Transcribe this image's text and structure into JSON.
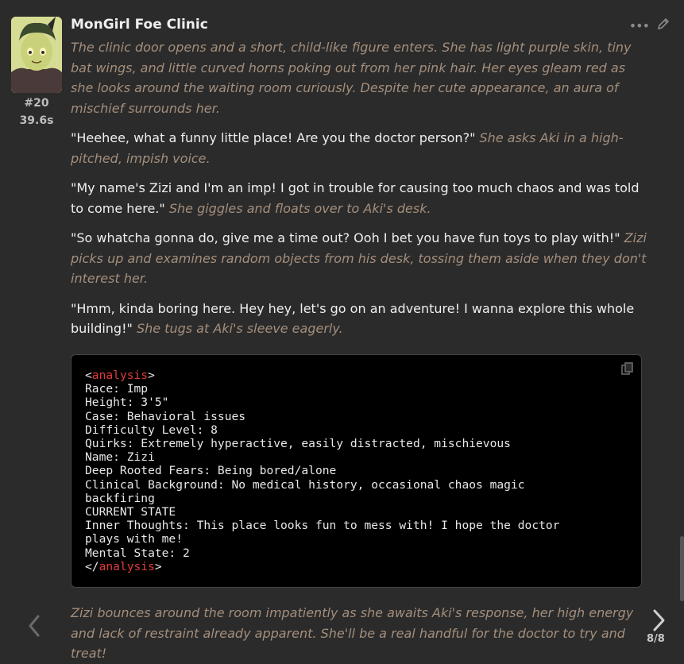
{
  "message": {
    "character_name": "MonGirl Foe Clinic",
    "number": "#20",
    "time": "39.6s",
    "paragraphs": [
      {
        "narration": "The clinic door opens and a short, child-like figure enters. She has light purple skin, tiny bat wings, and little curved horns poking out from her pink hair. Her eyes gleam red as she looks around the waiting room curiously. Despite her cute appearance, an aura of mischief surrounds her."
      },
      {
        "speech": "\"Heehee, what a funny little place! Are you the doctor person?\"",
        "narration": "She asks Aki in a high-pitched, impish voice."
      },
      {
        "speech": "\"My name's Zizi and I'm an imp! I got in trouble for causing too much chaos and was told to come here.\"",
        "narration": "She giggles and floats over to Aki's desk."
      },
      {
        "speech": "\"So whatcha gonna do, give me a time out? Ooh I bet you have fun toys to play with!\"",
        "narration": "Zizi picks up and examines random objects from his desk, tossing them aside when they don't interest her."
      },
      {
        "speech": "\"Hmm, kinda boring here. Hey hey, let's go on an adventure! I wanna explore this whole building!\"",
        "narration": "She tugs at Aki's sleeve eagerly."
      }
    ],
    "code": {
      "open_tag": "analysis",
      "close_tag": "analysis",
      "lines": [
        "Race: Imp",
        "Height: 3'5\"",
        "Case: Behavioral issues",
        "Difficulty Level: 8",
        "Quirks: Extremely hyperactive, easily distracted, mischievous",
        "Name: Zizi",
        "Deep Rooted Fears: Being bored/alone",
        "Clinical Background: No medical history, occasional chaos magic",
        "backfiring",
        "CURRENT STATE",
        "Inner Thoughts: This place looks fun to mess with! I hope the doctor",
        "plays with me!",
        "Mental State: 2"
      ]
    },
    "footer_narration": "Zizi bounces around the room impatiently as she awaits Aki's response, her high energy and lack of restraint already apparent. She'll be a real handful for the doctor to try and treat!"
  },
  "navigation": {
    "page": "8/8",
    "prev_icon": "chevron-left-icon",
    "next_icon": "chevron-right-icon"
  },
  "colors": {
    "background": "#2b2b2b",
    "narration": "#a48e7c",
    "tag": "#e23a3a",
    "code_bg": "#000000"
  }
}
